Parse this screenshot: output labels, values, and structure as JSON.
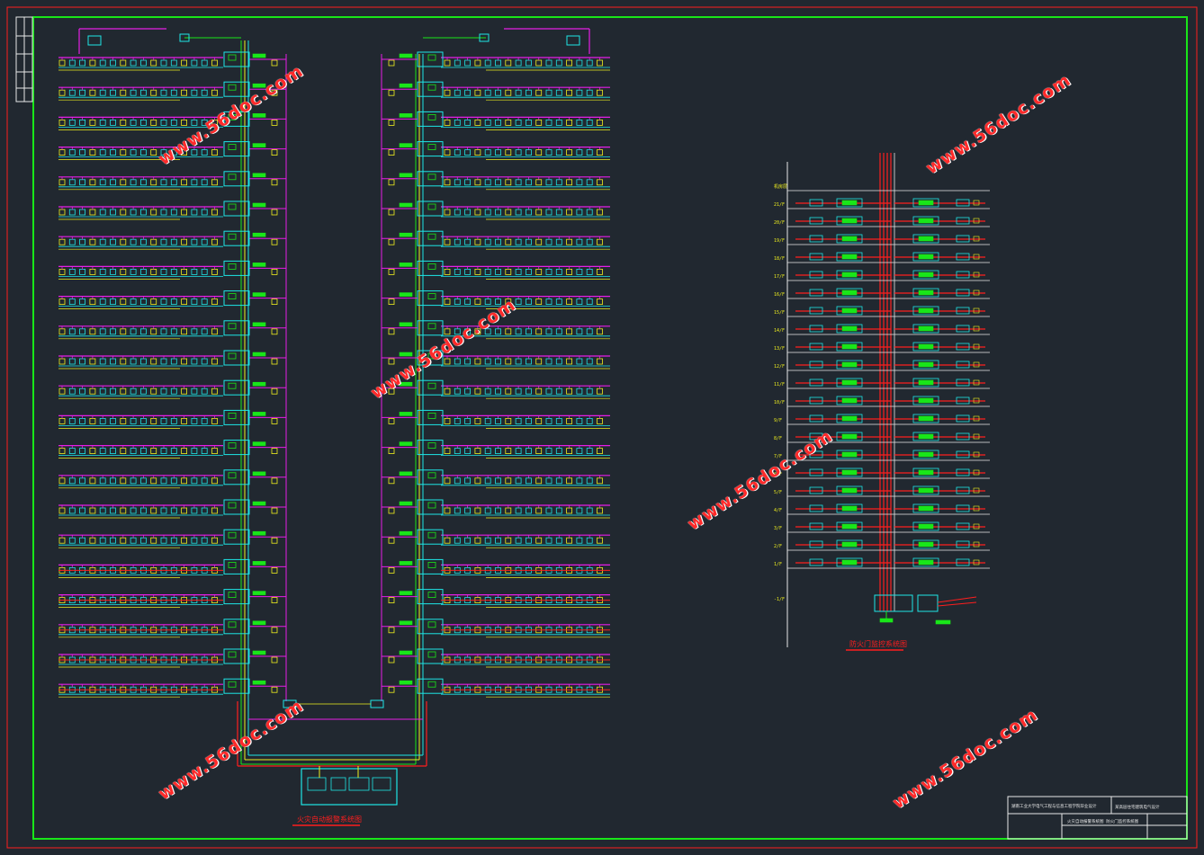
{
  "drawing": {
    "left_caption": "火灾自动报警系统图",
    "right_caption": "防火门监控系统图",
    "floors_right": [
      "机房层",
      "21/F",
      "20/F",
      "19/F",
      "18/F",
      "17/F",
      "16/F",
      "15/F",
      "14/F",
      "13/F",
      "12/F",
      "11/F",
      "10/F",
      "9/F",
      "8/F",
      "7/F",
      "6/F",
      "5/F",
      "4/F",
      "3/F",
      "2/F",
      "1/F",
      "-1/F"
    ],
    "title_block": {
      "school": "湖南工业大学电气工程与信息工程学院毕业设计",
      "project": "某高层住宅建筑电气设计",
      "sheet_title": "火灾自动报警系统图 防火门监控系统图"
    }
  },
  "watermarks": [
    "www.56doc.com",
    "www.56doc.com",
    "www.56doc.com",
    "www.56doc.com",
    "www.56doc.com",
    "www.56doc.com"
  ],
  "colors": {
    "background": "#212830",
    "frame": "#19e619",
    "red": "#ff1e1e",
    "magenta": "#e61ee6",
    "cyan": "#1ee6e6",
    "yellow": "#f0f01e",
    "white": "#e8e8e8",
    "green": "#19e619"
  }
}
